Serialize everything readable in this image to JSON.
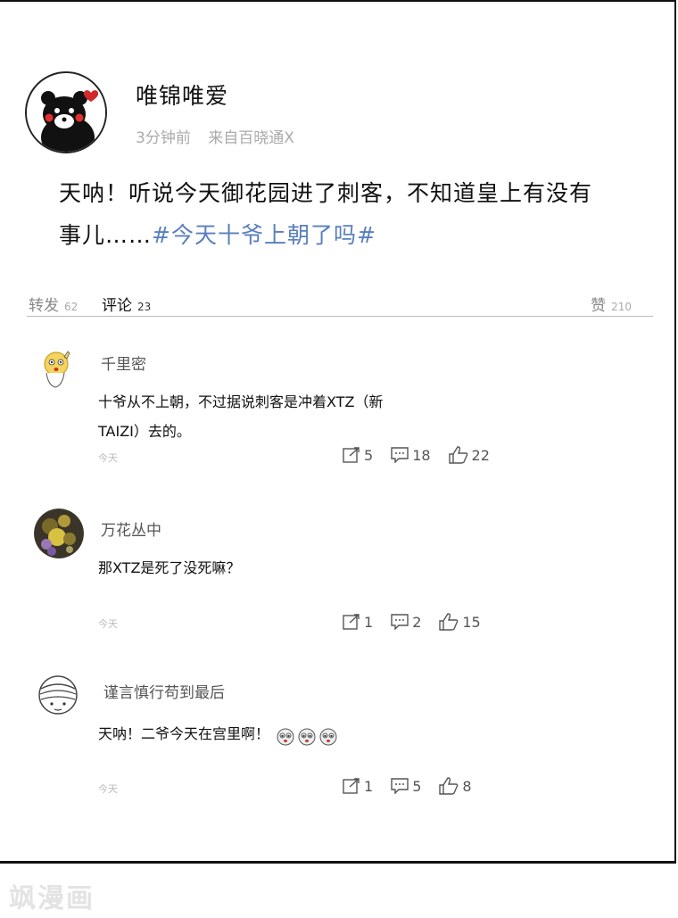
{
  "post": {
    "author": "唯锦唯爱",
    "time": "3分钟前",
    "source": "来自百晓通X",
    "body_text": "天呐！听说今天御花园进了刺客，不知道皇上有没有事儿……",
    "hashtag": "#今天十爷上朝了吗#"
  },
  "tabs": {
    "repost_label": "转发",
    "repost_count": "62",
    "comments_label": "评论",
    "comments_count": "23",
    "likes_label": "赞",
    "likes_count": "210"
  },
  "comments": [
    {
      "name": "千里密",
      "text": "十爷从不上朝，不过据说刺客是冲着XTZ（新TAIZI）去的。",
      "time": "今天",
      "reposts": "5",
      "replies": "18",
      "likes": "22"
    },
    {
      "name": "万花丛中",
      "text": "那XTZ是死了没死嘛？",
      "time": "今天",
      "reposts": "1",
      "replies": "2",
      "likes": "15"
    },
    {
      "name": "谨言慎行苟到最后",
      "text": "天呐！二爷今天在宫里啊！",
      "time": "今天",
      "reposts": "1",
      "replies": "5",
      "likes": "8"
    }
  ],
  "watermark": "飒漫画",
  "icons": {
    "repost": "repost-icon",
    "reply": "comment-bubble-icon",
    "like": "thumbs-up-icon",
    "emoji": "crying-face-emoji"
  },
  "colors": {
    "hashtag": "#5a7fbd",
    "meta": "#aaaaaa"
  }
}
